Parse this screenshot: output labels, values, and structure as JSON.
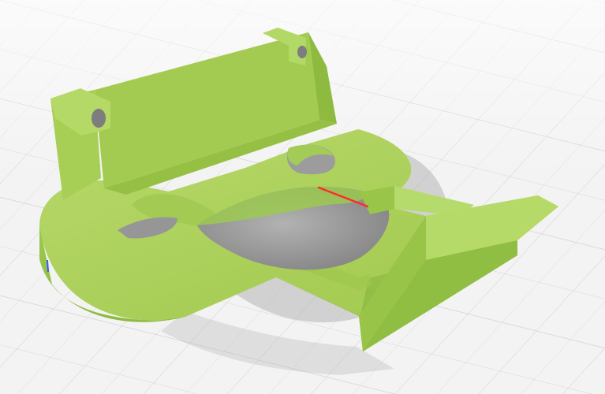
{
  "viewer": {
    "background_color": "#f3f3f3",
    "grid_color": "#ffffff",
    "grid_line_color": "#d9d9d9",
    "part_color": "#a9cf54",
    "part_shadow_color": "#8fbc3f",
    "part_dark_color": "#7ea734",
    "hole_shadow_color": "#9a9a9a",
    "error_highlight_color": "#ff2a2a",
    "edge_accent_color": "#3d57ff"
  },
  "model": {
    "icon": "3d-part",
    "state": "selected"
  }
}
